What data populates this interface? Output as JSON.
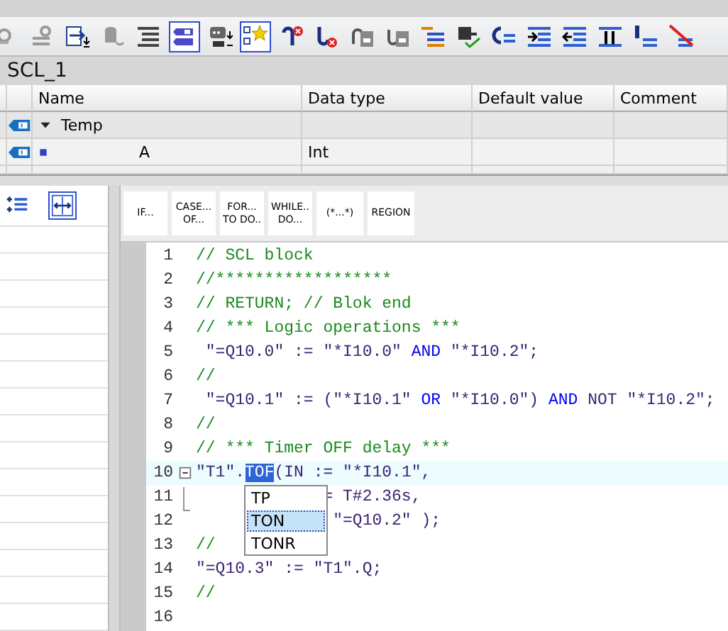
{
  "toolbar": [
    {
      "pressed": false
    },
    {
      "pressed": false
    },
    {
      "pressed": false
    },
    {
      "pressed": false
    },
    {
      "pressed": false
    },
    {
      "pressed": true
    },
    {
      "pressed": false
    },
    {
      "pressed": true
    },
    {
      "pressed": false
    },
    {
      "pressed": false
    },
    {
      "pressed": false
    },
    {
      "pressed": false
    },
    {
      "pressed": false
    },
    {
      "pressed": false
    },
    {
      "pressed": false
    },
    {
      "pressed": false
    },
    {
      "pressed": false
    },
    {
      "pressed": false
    },
    {
      "pressed": false
    },
    {
      "pressed": false
    }
  ],
  "block_title": "SCL_1",
  "interface_table": {
    "columns": [
      "Name",
      "Data type",
      "Default value",
      "Comment"
    ],
    "rows": [
      {
        "kind": "section",
        "name": "Temp",
        "expanded": true,
        "data_type": ""
      },
      {
        "kind": "variable",
        "name": "A",
        "data_type": "Int"
      }
    ]
  },
  "side_panel": {
    "tools": [
      {
        "pressed": false
      },
      {
        "pressed": true
      }
    ]
  },
  "snippets": [
    {
      "lines": [
        "IF..."
      ]
    },
    {
      "lines": [
        "CASE...",
        "OF..."
      ]
    },
    {
      "lines": [
        "FOR...",
        "TO DO.."
      ]
    },
    {
      "lines": [
        "WHILE..",
        "DO..."
      ]
    },
    {
      "lines": [
        "(*...*)"
      ]
    },
    {
      "lines": [
        "REGION"
      ]
    }
  ],
  "code": {
    "lines": [
      {
        "number": "1",
        "current": false,
        "tokens": [
          {
            "kind": "comment",
            "text": "// SCL block"
          }
        ]
      },
      {
        "number": "2",
        "current": false,
        "tokens": [
          {
            "kind": "comment",
            "text": "//******************"
          }
        ]
      },
      {
        "number": "3",
        "current": false,
        "tokens": [
          {
            "kind": "comment",
            "text": "// RETURN; // Blok end"
          }
        ]
      },
      {
        "number": "4",
        "current": false,
        "tokens": [
          {
            "kind": "comment",
            "text": "// *** Logic operations ***"
          }
        ]
      },
      {
        "number": "5",
        "current": false,
        "tokens": [
          {
            "kind": "code",
            "text": " \"=Q10.0\" := \"*I10.0\" "
          },
          {
            "kind": "keyword",
            "text": "AND"
          },
          {
            "kind": "code",
            "text": " \"*I10.2\";"
          }
        ]
      },
      {
        "number": "6",
        "current": false,
        "tokens": [
          {
            "kind": "comment",
            "text": "//"
          }
        ]
      },
      {
        "number": "7",
        "current": false,
        "tokens": [
          {
            "kind": "code",
            "text": " \"=Q10.1\" := (\"*I10.1\" "
          },
          {
            "kind": "keyword",
            "text": "OR"
          },
          {
            "kind": "code",
            "text": " \"*I10.0\") "
          },
          {
            "kind": "keyword",
            "text": "AND"
          },
          {
            "kind": "code",
            "text": " NOT \"*I10.2\";"
          }
        ]
      },
      {
        "number": "8",
        "current": false,
        "tokens": [
          {
            "kind": "comment",
            "text": "//"
          }
        ]
      },
      {
        "number": "9",
        "current": false,
        "tokens": [
          {
            "kind": "comment",
            "text": "// *** Timer OFF delay ***"
          }
        ]
      },
      {
        "number": "10",
        "current": true,
        "fold": true,
        "tokens": [
          {
            "kind": "code",
            "text": "\"T1\"."
          },
          {
            "kind": "selected",
            "text": "TOF"
          },
          {
            "kind": "code",
            "text": "(IN := \"*I10.1\","
          }
        ]
      },
      {
        "number": "11",
        "current": false,
        "tokens": [
          {
            "kind": "code",
            "text": "             = T#2.36s,"
          }
        ]
      },
      {
        "number": "12",
        "current": false,
        "tokens": [
          {
            "kind": "code",
            "text": "              \"=Q10.2\" );"
          }
        ]
      },
      {
        "number": "13",
        "current": false,
        "tokens": [
          {
            "kind": "comment",
            "text": "//"
          }
        ]
      },
      {
        "number": "14",
        "current": false,
        "tokens": [
          {
            "kind": "code",
            "text": "\"=Q10.3\" := \"T1\".Q;"
          }
        ]
      },
      {
        "number": "15",
        "current": false,
        "tokens": [
          {
            "kind": "comment",
            "text": "//"
          }
        ]
      },
      {
        "number": "16",
        "current": false
      }
    ]
  },
  "completion_list": [
    {
      "label": "TP",
      "selected": false
    },
    {
      "label": "TON",
      "selected": true
    },
    {
      "label": "TONR",
      "selected": false
    }
  ]
}
